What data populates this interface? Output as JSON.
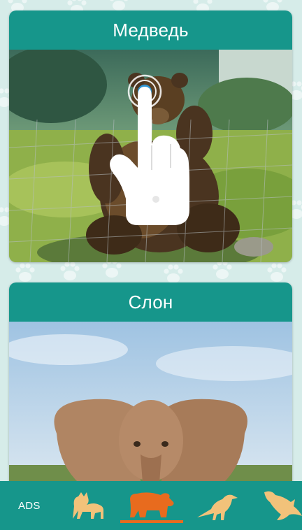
{
  "cards": [
    {
      "title": "Медведь",
      "image_icon": "bear-photo"
    },
    {
      "title": "Слон",
      "image_icon": "elephant-photo"
    }
  ],
  "overlay": {
    "icon": "tap-hand-icon"
  },
  "bottom_nav": {
    "ads_label": "ADS",
    "items": [
      {
        "icon": "cat-icon",
        "active": false
      },
      {
        "icon": "bear-icon",
        "active": true
      },
      {
        "icon": "bird-icon",
        "active": false
      },
      {
        "icon": "dolphin-icon",
        "active": false
      }
    ]
  },
  "colors": {
    "background": "#d6ece9",
    "header": "#16968b",
    "nav_bar": "#16968b",
    "icon_inactive": "#f2c27a",
    "icon_active": "#e86b1e"
  }
}
